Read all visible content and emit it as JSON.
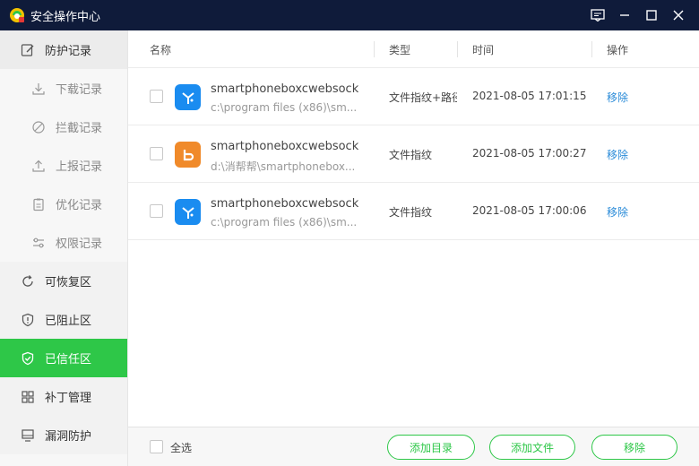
{
  "window": {
    "title": "安全操作中心",
    "controls": [
      "feedback-icon",
      "minimize-icon",
      "maximize-icon",
      "close-icon"
    ]
  },
  "sidebar": {
    "items": [
      {
        "label": "防护记录",
        "icon": "edit-note-icon"
      },
      {
        "label": "下载记录",
        "icon": "download-icon"
      },
      {
        "label": "拦截记录",
        "icon": "block-icon"
      },
      {
        "label": "上报记录",
        "icon": "upload-icon"
      },
      {
        "label": "优化记录",
        "icon": "clipboard-icon"
      },
      {
        "label": "权限记录",
        "icon": "sliders-icon"
      },
      {
        "label": "可恢复区",
        "icon": "refresh-icon"
      },
      {
        "label": "已阻止区",
        "icon": "shield-alert-icon"
      },
      {
        "label": "已信任区",
        "icon": "shield-check-icon"
      },
      {
        "label": "补丁管理",
        "icon": "grid-icon"
      },
      {
        "label": "漏洞防护",
        "icon": "monitor-icon"
      }
    ],
    "active_color": "#2ec748"
  },
  "table": {
    "headers": {
      "name": "名称",
      "type": "类型",
      "time": "时间",
      "op": "操作"
    },
    "rows": [
      {
        "name": "smartphoneboxcwebsock...",
        "path": "c:\\program files (x86)\\sm...",
        "type": "文件指纹+路径",
        "time": "2021-08-05 17:01:15",
        "op": "移除",
        "icon": "blue-antenna-icon"
      },
      {
        "name": "smartphoneboxcwebsock...",
        "path": "d:\\消帮帮\\smartphonebox...",
        "type": "文件指纹",
        "time": "2021-08-05 17:00:27",
        "op": "移除",
        "icon": "orange-b-icon"
      },
      {
        "name": "smartphoneboxcwebsock...",
        "path": "c:\\program files (x86)\\sm...",
        "type": "文件指纹",
        "time": "2021-08-05 17:00:06",
        "op": "移除",
        "icon": "blue-antenna-icon"
      }
    ]
  },
  "footer": {
    "select_all": "全选",
    "add_dir": "添加目录",
    "add_file": "添加文件",
    "remove": "移除"
  }
}
